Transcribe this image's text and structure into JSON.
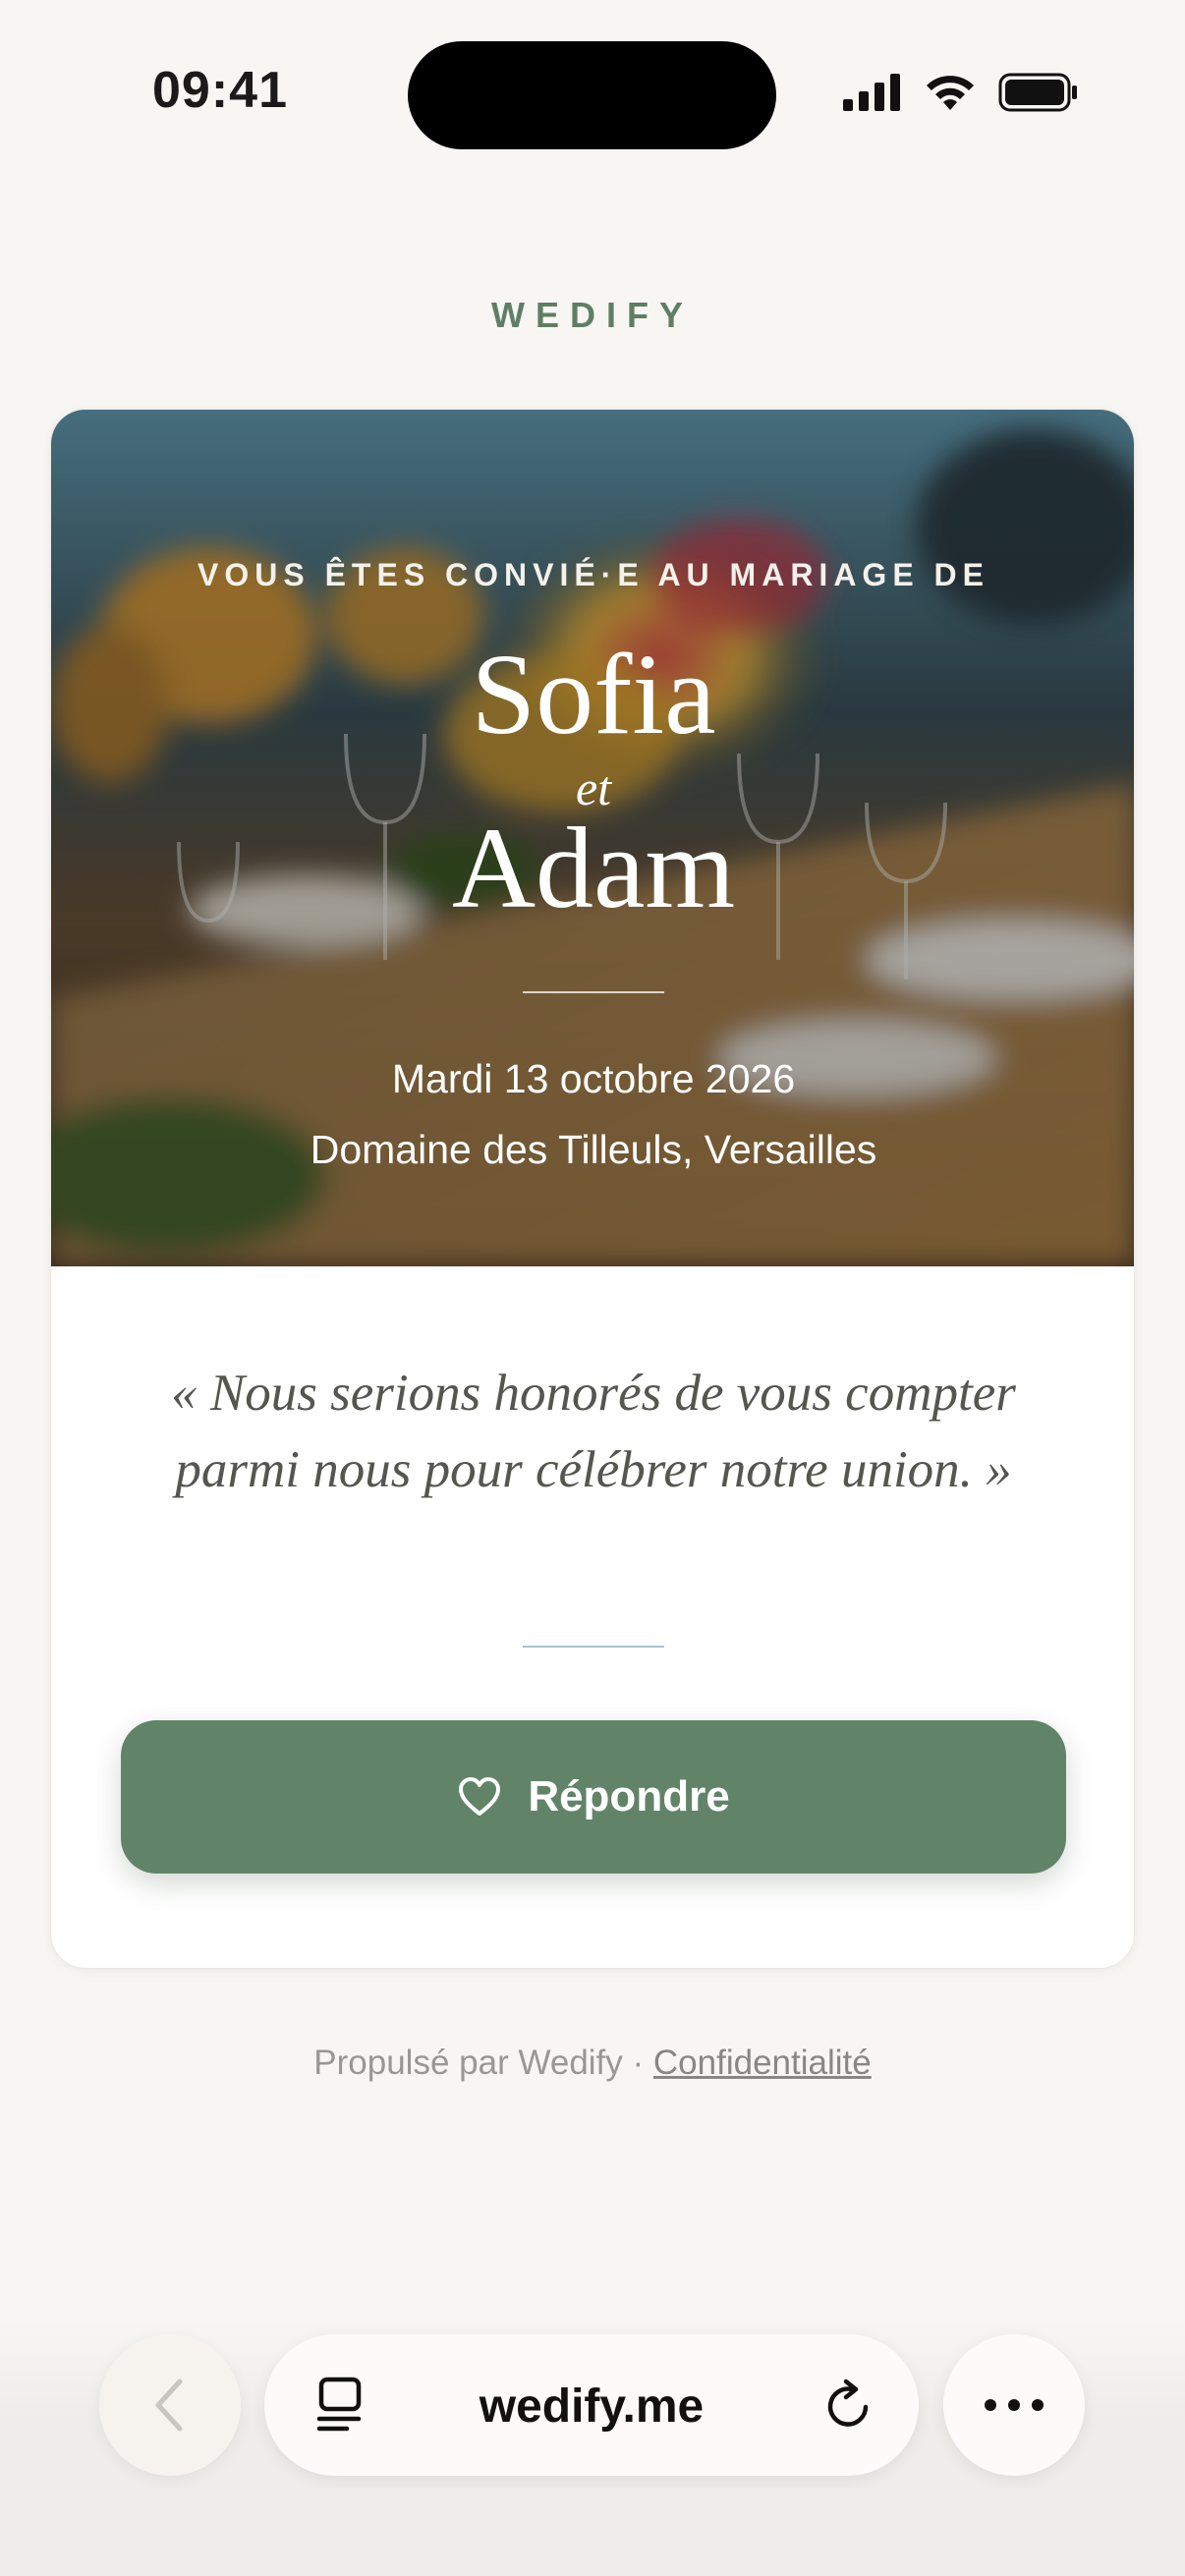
{
  "status_bar": {
    "time": "09:41"
  },
  "brand": {
    "name": "WEDIFY"
  },
  "invitation": {
    "kicker": "VOUS ÊTES CONVIÉ·E AU MARIAGE DE",
    "partner1": "Sofia",
    "conjunction": "et",
    "partner2": "Adam",
    "date": "Mardi 13 octobre 2026",
    "venue": "Domaine des Tilleuls, Versailles",
    "quote": "« Nous serions honorés de vous compter parmi nous pour célébrer notre union. »",
    "respond_label": "Répondre"
  },
  "footer": {
    "powered_by": "Propulsé par Wedify ·",
    "privacy_link": "Confidentialité"
  },
  "browser": {
    "url": "wedify.me"
  },
  "colors": {
    "accent": "#618468",
    "brand": "#5f7e66",
    "background": "#f8f6f3"
  }
}
